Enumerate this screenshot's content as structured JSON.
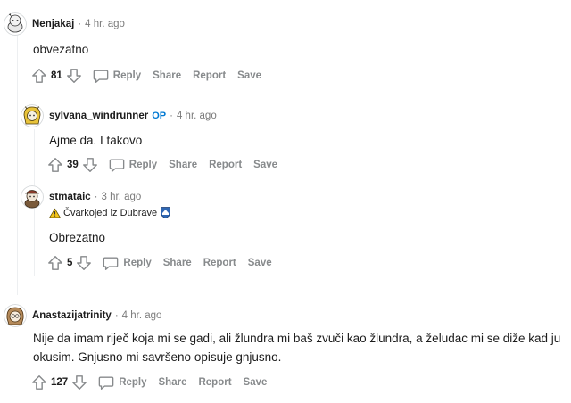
{
  "comments": [
    {
      "author": "Nenjakaj",
      "time": "4 hr. ago",
      "body": "obvezatno",
      "score": "81",
      "avatar_icon": "snoo-avatar-gray"
    },
    {
      "author": "sylvana_windrunner",
      "op_badge": "OP",
      "time": "4 hr. ago",
      "body": "Ajme da. I takovo",
      "score": "39",
      "avatar_icon": "snoo-avatar-yellow-helmet"
    },
    {
      "author": "stmataic",
      "time": "3 hr. ago",
      "flair": "Čvarkojed iz Dubrave",
      "flair_icons": [
        "warning-icon",
        "crest-icon"
      ],
      "body": "Obrezatno",
      "score": "5",
      "avatar_icon": "snoo-avatar-cap"
    },
    {
      "author": "Anastazijatrinity",
      "time": "4 hr. ago",
      "body_lines": [
        "Nije da imam riječ koja mi se gadi, ali žlundra mi baš zvuči kao žlundra, a želudac mi se diže kad ju",
        "okusim. Gnjusno mi savršeno opisuje gnjusno."
      ],
      "score": "127",
      "avatar_icon": "snoo-avatar-glasses"
    }
  ],
  "actions": {
    "reply": "Reply",
    "share": "Share",
    "report": "Report",
    "save": "Save"
  },
  "separator": "·",
  "colors": {
    "op": "#0079d3",
    "meta": "#7c7c7c",
    "action": "#878a8c",
    "thread_line": "#edeff1"
  }
}
